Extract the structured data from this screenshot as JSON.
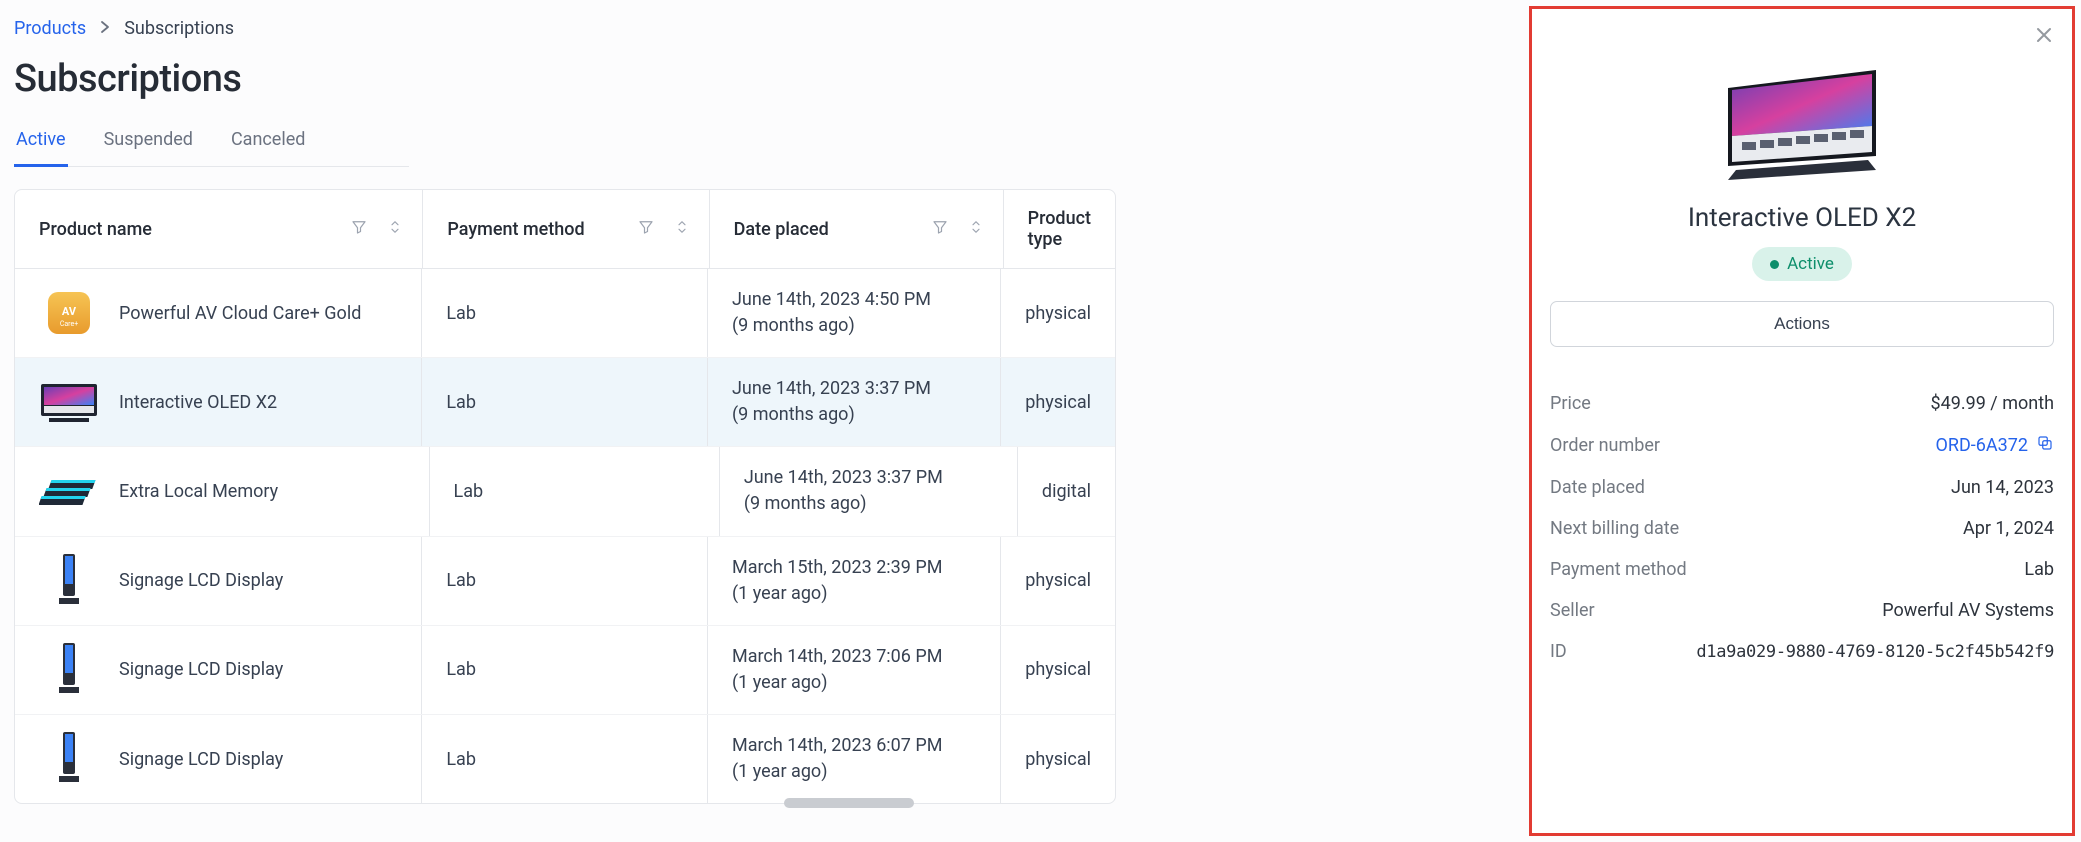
{
  "breadcrumb": {
    "parent": "Products",
    "current": "Subscriptions"
  },
  "page_title": "Subscriptions",
  "tabs": [
    {
      "label": "Active",
      "active": true
    },
    {
      "label": "Suspended",
      "active": false
    },
    {
      "label": "Canceled",
      "active": false
    }
  ],
  "columns": {
    "product": "Product name",
    "payment": "Payment method",
    "date": "Date placed",
    "type": "Product type"
  },
  "rows": [
    {
      "name": "Powerful AV Cloud Care+ Gold",
      "payment": "Lab",
      "date": "June 14th, 2023 4:50 PM",
      "rel": "(9 months ago)",
      "type": "physical",
      "selected": false,
      "icon": "gold-badge"
    },
    {
      "name": "Interactive OLED X2",
      "payment": "Lab",
      "date": "June 14th, 2023 3:37 PM",
      "rel": "(9 months ago)",
      "type": "physical",
      "selected": true,
      "icon": "tv"
    },
    {
      "name": "Extra Local Memory",
      "payment": "Lab",
      "date": "June 14th, 2023 3:37 PM",
      "rel": "(9 months ago)",
      "type": "digital",
      "selected": false,
      "icon": "ram"
    },
    {
      "name": "Signage LCD Display",
      "payment": "Lab",
      "date": "March 15th, 2023 2:39 PM",
      "rel": "(1 year ago)",
      "type": "physical",
      "selected": false,
      "icon": "signage"
    },
    {
      "name": "Signage LCD Display",
      "payment": "Lab",
      "date": "March 14th, 2023 7:06 PM",
      "rel": "(1 year ago)",
      "type": "physical",
      "selected": false,
      "icon": "signage"
    },
    {
      "name": "Signage LCD Display",
      "payment": "Lab",
      "date": "March 14th, 2023 6:07 PM",
      "rel": "(1 year ago)",
      "type": "physical",
      "selected": false,
      "icon": "signage"
    }
  ],
  "panel": {
    "title": "Interactive OLED X2",
    "status": "Active",
    "actions_label": "Actions",
    "fields": {
      "price_label": "Price",
      "price_value": "$49.99 / month",
      "order_label": "Order number",
      "order_value": "ORD-6A372",
      "date_label": "Date placed",
      "date_value": "Jun 14, 2023",
      "next_label": "Next billing date",
      "next_value": "Apr 1, 2024",
      "payment_label": "Payment method",
      "payment_value": "Lab",
      "seller_label": "Seller",
      "seller_value": "Powerful AV Systems",
      "id_label": "ID",
      "id_value": "d1a9a029-9880-4769-8120-5c2f45b542f9"
    }
  }
}
